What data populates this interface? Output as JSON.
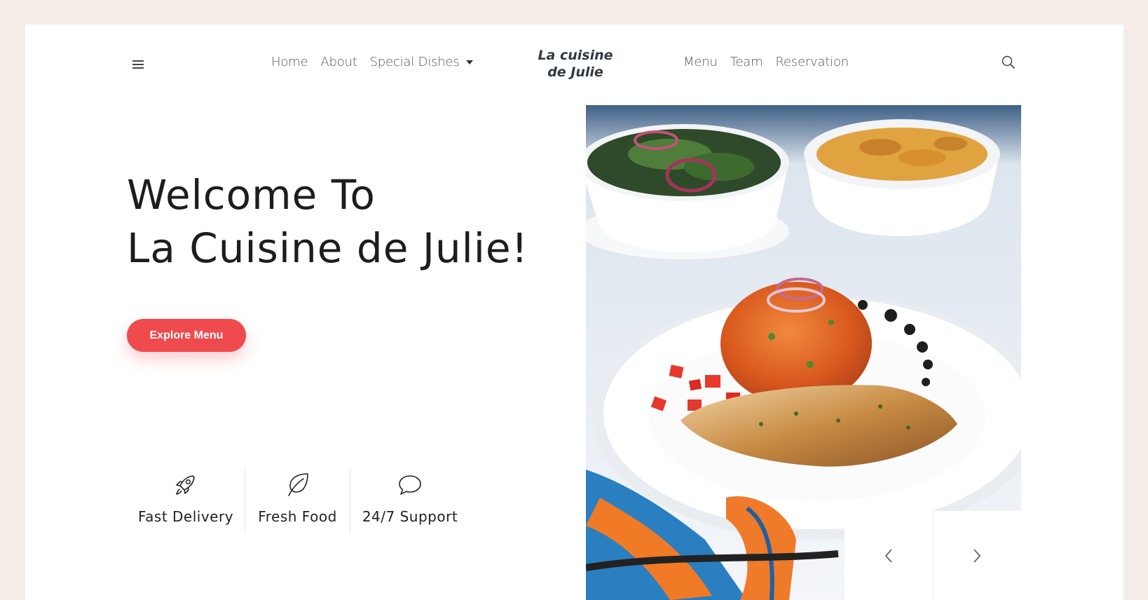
{
  "header": {
    "logo_line1": "La cuisine",
    "logo_line2": "de Julie",
    "nav_left": [
      "Home",
      "About",
      "Special Dishes"
    ],
    "nav_right": [
      "Menu",
      "Team",
      "Reservation"
    ],
    "menu_icon": "hamburger-icon",
    "search_icon": "search-icon",
    "dropdown_icon": "caret-down-icon"
  },
  "hero": {
    "title_line1": "Welcome To",
    "title_line2": "La Cuisine de Julie!",
    "cta_label": "Explore Menu"
  },
  "features": [
    {
      "label": "Fast Delivery",
      "icon": "rocket-icon"
    },
    {
      "label": "Fresh Food",
      "icon": "leaf-icon"
    },
    {
      "label": "24/7 Support",
      "icon": "chat-bubble-icon"
    }
  ],
  "slider": {
    "prev_icon": "chevron-left-icon",
    "next_icon": "chevron-right-icon"
  },
  "colors": {
    "accent": "#ef4b4e",
    "page_bg": "#f4ece7",
    "logo": "#2d3a45"
  }
}
